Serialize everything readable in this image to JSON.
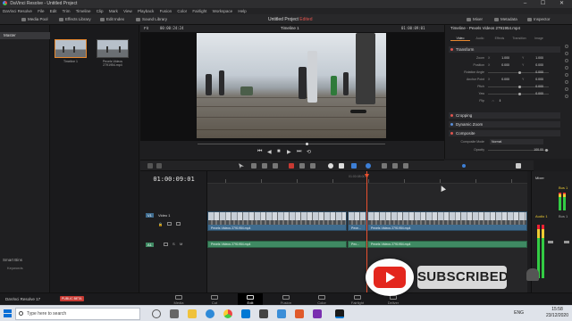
{
  "window": {
    "title": "DaVinci Resolve - Untitled Project",
    "controls": "– ☐ ✕"
  },
  "menu": [
    "DaVinci Resolve",
    "File",
    "Edit",
    "Trim",
    "Timeline",
    "Clip",
    "Mark",
    "View",
    "Playback",
    "Fusion",
    "Color",
    "Fairlight",
    "Workspace",
    "Help"
  ],
  "toolbar": {
    "media_pool": "Media Pool",
    "effects_library": "Effects Library",
    "edit_index": "Edit Index",
    "sound_library": "Sound Library",
    "project_title": "Untitled Project",
    "project_status": "Edited",
    "mixer": "Mixer",
    "metadata": "Metadata",
    "inspector": "Inspector"
  },
  "bins": {
    "master": "Master",
    "smart_bins": "Smart Bins",
    "keywords": "Keywords"
  },
  "media_pool": {
    "clips": [
      {
        "label": "Timeline 1"
      },
      {
        "label": "Pexels Videos 2791954.mp4"
      }
    ]
  },
  "viewer": {
    "fit": "Fit",
    "source_timecode": "00:00:24:24",
    "timeline_name": "Timeline 1",
    "record_timecode": "01:00:09:01"
  },
  "inspector": {
    "header": "Timeline - Pexels Videos 2791954.mp4",
    "tabs": [
      "Video",
      "Audio",
      "Effects",
      "Transition",
      "Image",
      "File"
    ],
    "sections": {
      "transform": "Transform",
      "cropping": "Cropping",
      "dynamic_zoom": "Dynamic Zoom",
      "composite": "Composite"
    },
    "rows": [
      {
        "label": "Zoom",
        "x_tag": "X",
        "x": "1.000",
        "y_tag": "Y",
        "y": "1.000"
      },
      {
        "label": "Position",
        "x_tag": "X",
        "x": "0.000",
        "y_tag": "Y",
        "y": "0.000"
      },
      {
        "label": "Rotation Angle",
        "x": "0.000"
      },
      {
        "label": "Anchor Point",
        "x_tag": "X",
        "x": "0.000",
        "y_tag": "Y",
        "y": "0.000"
      },
      {
        "label": "Pitch",
        "x": "0.000"
      },
      {
        "label": "Yaw",
        "x": "0.000"
      },
      {
        "label": "Flip"
      }
    ],
    "composite_mode_label": "Composite Mode",
    "composite_mode_value": "Normal",
    "opacity_label": "Opacity",
    "opacity_value": "100.00"
  },
  "timeline": {
    "timecode": "01:00:09:01",
    "ruler_timecode": "01:00:08:00",
    "playhead_position_fraction": 0.5,
    "tracks": {
      "video": {
        "id": "V1",
        "name": "Video 1",
        "clips": [
          "Pexels Videos 2791954.mp4",
          "Pexe...",
          "Pexels Videos 2791954.mp4"
        ]
      },
      "audio": {
        "id": "A1",
        "clips": [
          "Pexels Videos 2791954.mp4",
          "Pex...",
          "Pexels Videos 2791954.mp4"
        ]
      }
    }
  },
  "mixer": {
    "title": "Mixer",
    "bus": "Bus 1",
    "track": "Audio 1",
    "bus_short": "Bus 1"
  },
  "pagebar": {
    "brand": "DaVinci Resolve 17",
    "beta": "PUBLIC BETA",
    "pages": [
      "Media",
      "Cut",
      "Edit",
      "Fusion",
      "Color",
      "Fairlight",
      "Deliver"
    ],
    "active_page": "Edit"
  },
  "overlay": {
    "subscribe": "SUBSCRIBED"
  },
  "taskbar": {
    "search_placeholder": "Type here to search",
    "language": "ENG",
    "time": "15:58",
    "date": "23/12/2020"
  },
  "colors": {
    "accent": "#e8892f",
    "playhead": "#e8502f",
    "video_clip": "#3f6c8f",
    "audio_clip": "#3f8a63",
    "youtube_red": "#e3261d"
  }
}
